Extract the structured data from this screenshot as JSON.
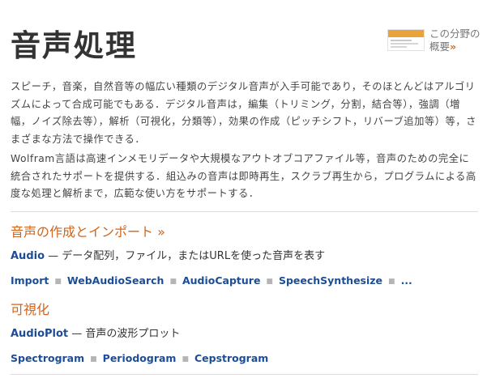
{
  "page_title": "音声処理",
  "overview": {
    "label": "この分野の概要",
    "arrow": "»"
  },
  "paragraphs": [
    "スピーチ，音楽，自然音等の幅広い種類のデジタル音声が入手可能であり，そのほとんどはアルゴリズムによって合成可能でもある．デジタル音声は，編集（トリミング，分割，結合等），強調（増幅，ノイズ除去等），解析（可視化，分類等），効果の作成（ピッチシフト，リバーブ追加等）等，さまざまな方法で操作できる．",
    "Wolfram言語は高速インメモリデータや大規模なアウトオブコアファイル等，音声のための完全に統合されたサポートを提供する．組込みの音声は即時再生，スクラブ再生から，プログラムによる高度な処理と解析まで，広範な使い方をサポートする．"
  ],
  "sections": [
    {
      "heading": "音声の作成とインポート »",
      "primary": {
        "name": "Audio",
        "desc": " — データ配列，ファイル，またはURLを使った音声を表す"
      },
      "links": [
        "Import",
        "WebAudioSearch",
        "AudioCapture",
        "SpeechSynthesize",
        "..."
      ]
    },
    {
      "heading": "可視化",
      "primary": {
        "name": "AudioPlot",
        "desc": " — 音声の波形プロット"
      },
      "links": [
        "Spectrogram",
        "Periodogram",
        "Cepstrogram"
      ]
    }
  ],
  "colors": {
    "heading_orange": "#d0651c",
    "link_blue": "#1d4d96",
    "title_dark": "#333333",
    "separator_gray": "#b5b5b5"
  },
  "icons": {
    "separator": "■",
    "overview_thumbnail": "overview-thumbnail"
  }
}
